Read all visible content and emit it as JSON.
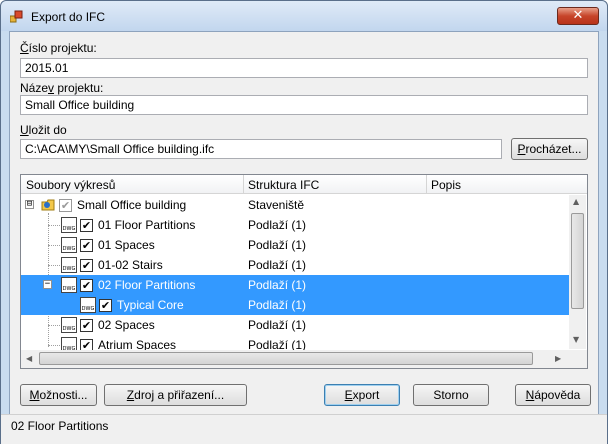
{
  "window": {
    "title": "Export do IFC",
    "close_glyph": "✕",
    "app_icon": "ifc-export-icon"
  },
  "fields": {
    "project_number": {
      "label_prefix": "",
      "label_accel": "Č",
      "label_rest": "íslo projektu:",
      "value": "2015.01"
    },
    "project_name": {
      "label_prefix": "Náze",
      "label_accel": "v",
      "label_rest": " projektu:",
      "value": "Small Office building"
    },
    "save_to": {
      "label_prefix": "",
      "label_accel": "U",
      "label_rest": "ložit do",
      "value": "C:\\ACA\\MY\\Small Office building.ifc"
    }
  },
  "browse_button": {
    "prefix": "",
    "accel": "P",
    "rest": "rocházet..."
  },
  "tree": {
    "columns": [
      "Soubory výkresů",
      "Struktura IFC",
      "Popis"
    ],
    "rows": [
      {
        "name": "Small Office building",
        "structure": "Staveniště",
        "checked": true,
        "icon": "project-folder-icon",
        "level": 0,
        "expander": "⊟",
        "selected": false
      },
      {
        "name": "01 Floor Partitions",
        "structure": "Podlaží (1)",
        "checked": true,
        "icon": "dwg-file-icon",
        "level": 1,
        "selected": false
      },
      {
        "name": "01 Spaces",
        "structure": "Podlaží (1)",
        "checked": true,
        "icon": "dwg-file-icon",
        "level": 1,
        "selected": false
      },
      {
        "name": "01-02 Stairs",
        "structure": "Podlaží (1)",
        "checked": true,
        "icon": "dwg-file-icon",
        "level": 1,
        "selected": false
      },
      {
        "name": "02 Floor Partitions",
        "structure": "Podlaží (1)",
        "checked": true,
        "icon": "dwg-file-icon",
        "level": 1,
        "expander": "−",
        "selected": true
      },
      {
        "name": "Typical Core",
        "structure": "Podlaží (1)",
        "checked": true,
        "icon": "dwg-file-icon",
        "level": 2,
        "selected": true
      },
      {
        "name": "02 Spaces",
        "structure": "Podlaží (1)",
        "checked": true,
        "icon": "dwg-file-icon",
        "level": 1,
        "selected": false
      },
      {
        "name": "Atrium Spaces",
        "structure": "Podlaží (1)",
        "checked": true,
        "icon": "dwg-file-icon",
        "level": 1,
        "selected": false
      }
    ],
    "dwg_label": "DWG",
    "check_glyph": "✔"
  },
  "buttons": {
    "options": {
      "prefix": "",
      "accel": "M",
      "rest": "ožnosti..."
    },
    "source": {
      "prefix": "",
      "accel": "Z",
      "rest": "droj a přiřazení..."
    },
    "export": {
      "prefix": "",
      "accel": "E",
      "rest": "xport"
    },
    "cancel": {
      "label": "Storno"
    },
    "help": {
      "prefix": "",
      "accel": "N",
      "rest": "ápověda"
    }
  },
  "status": {
    "text": "02 Floor Partitions"
  },
  "colors": {
    "selection": "#3399ff",
    "title_bar": "#c9dcef",
    "close": "#c7442a"
  }
}
